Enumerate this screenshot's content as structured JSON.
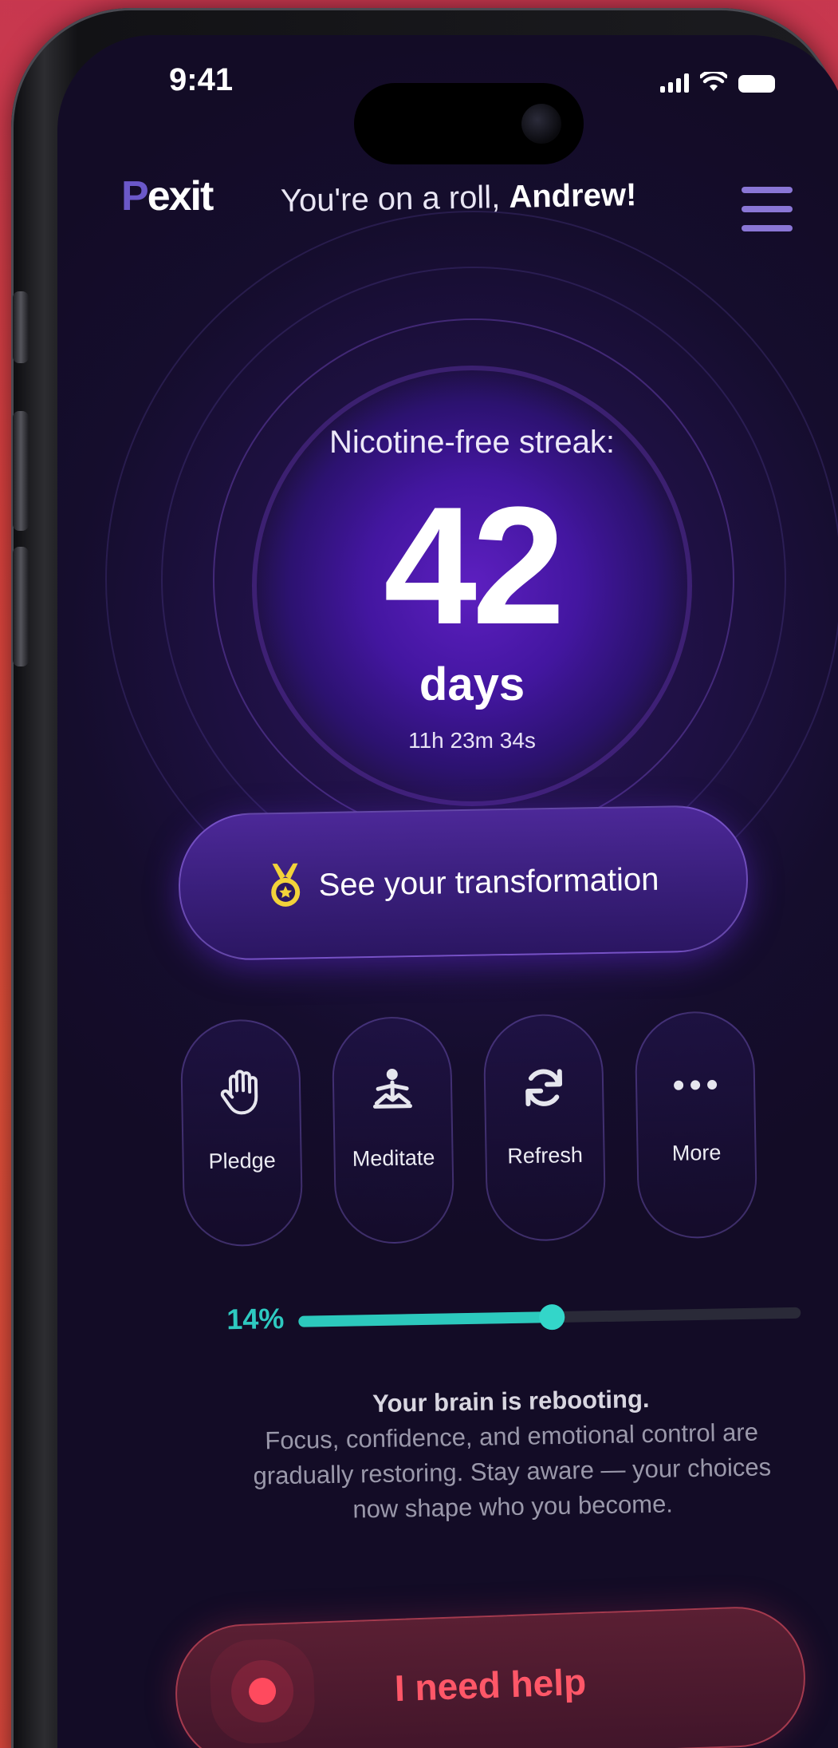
{
  "status_bar": {
    "time": "9:41"
  },
  "header": {
    "logo": "Pexit",
    "logo_first": "P",
    "logo_rest": "exit",
    "greeting_prefix": "You're on a roll,",
    "greeting_name": "Andrew!",
    "menu_icon": "hamburger-menu-icon"
  },
  "streak": {
    "label": "Nicotine-free streak:",
    "value": "42",
    "unit": "days",
    "elapsed": "11h 23m 34s"
  },
  "transformation_button": {
    "icon": "medal-icon",
    "label": "See your transformation"
  },
  "actions": [
    {
      "icon": "hand-icon",
      "label": "Pledge"
    },
    {
      "icon": "meditation-icon",
      "label": "Meditate"
    },
    {
      "icon": "refresh-icon",
      "label": "Refresh"
    },
    {
      "icon": "more-dots-icon",
      "label": "More"
    }
  ],
  "progress": {
    "percent_label": "14%",
    "value": 0.14
  },
  "message": {
    "heading": "Your brain is rebooting.",
    "body": "Focus, confidence, and emotional control are gradually restoring. Stay aware — your choices now shape who you become."
  },
  "help_button": {
    "label": "I need help"
  },
  "colors": {
    "accent_purple": "#6b58c9",
    "progress_teal": "#2cc9bd",
    "help_red": "#ff5768",
    "background": "#150d2d"
  }
}
